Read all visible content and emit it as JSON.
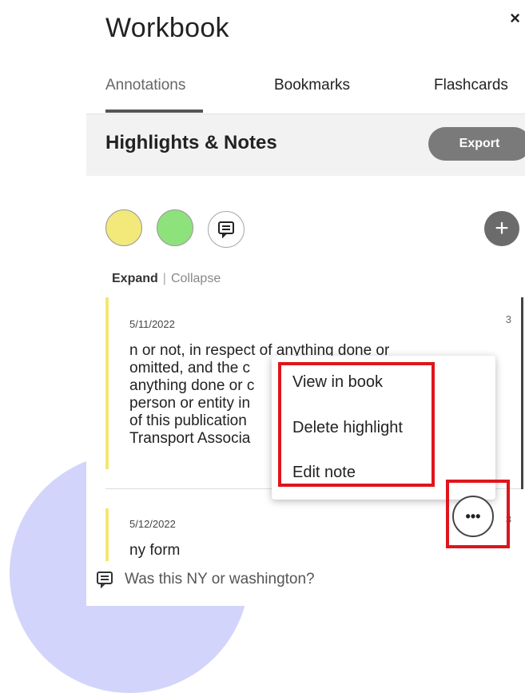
{
  "panel": {
    "title": "Workbook",
    "close_glyph": "×"
  },
  "tabs": [
    {
      "label": "Annotations",
      "active": true
    },
    {
      "label": "Bookmarks",
      "active": false
    },
    {
      "label": "Flashcards",
      "active": false
    }
  ],
  "header": {
    "title": "Highlights & Notes",
    "export_label": "Export"
  },
  "filters": {
    "swatches": [
      {
        "name": "yellow",
        "color": "#f2e97a"
      },
      {
        "name": "green",
        "color": "#8ee27c"
      }
    ],
    "note_icon": "note-icon",
    "add_label": "+"
  },
  "toggle": {
    "expand_label": "Expand",
    "separator": "|",
    "collapse_label": "Collapse"
  },
  "entries": [
    {
      "date": "5/11/2022",
      "count": "3",
      "text": "n or not, in respect of anything done or\nomitted, and the c\nanything done or c\nperson or entity in\nof this publication\nTransport Associa"
    },
    {
      "date": "5/12/2022",
      "count": "3",
      "text": "ny form",
      "note": "Was this NY or washington?"
    }
  ],
  "context_menu": {
    "items": [
      "View in book",
      "Delete highlight",
      "Edit note"
    ]
  },
  "more_button": {
    "glyph": "•••"
  },
  "colors": {
    "accent_red": "#e0141c",
    "highlight_yellow": "#f3e675",
    "decor_lavender": "#d3d4fb"
  }
}
